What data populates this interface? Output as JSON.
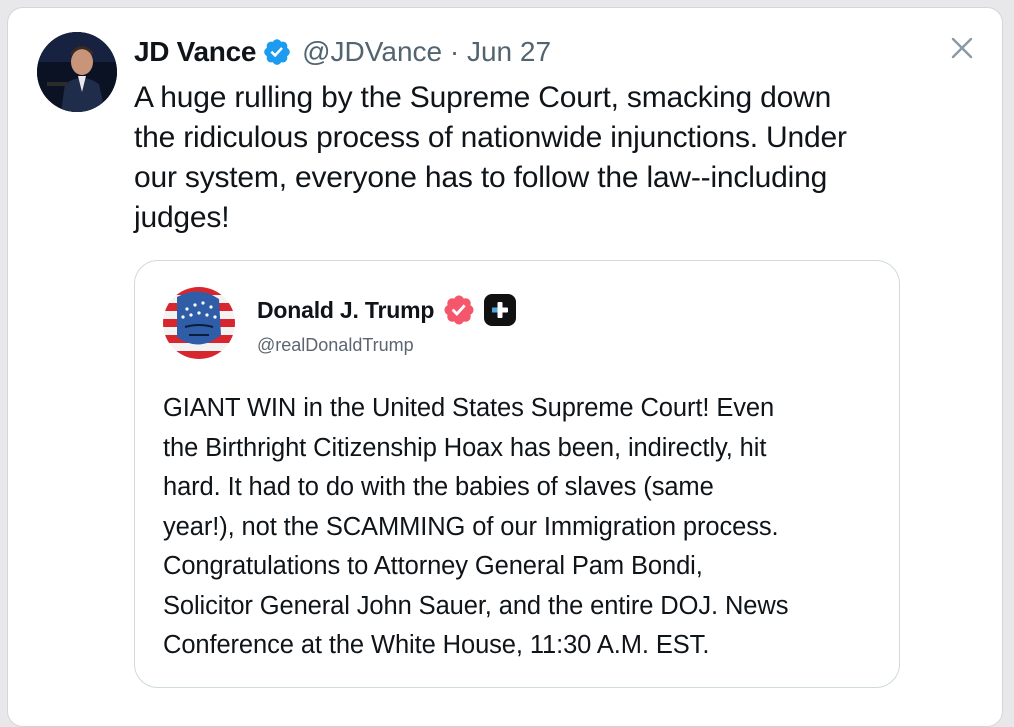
{
  "tweet": {
    "author_name": "JD Vance",
    "handle_date": "@JDVance · Jun 27",
    "text": "A huge rulling by the Supreme Court, smacking down\nthe ridiculous process of nationwide injunctions. Under\nour system, everyone has to follow the law--including\njudges!",
    "verified_icon": "verified-badge-icon",
    "verified_color": "#1d9bf0",
    "close_icon": "close-icon"
  },
  "quote": {
    "author_name": "Donald J. Trump",
    "handle": "@realDonaldTrump",
    "verified_icon": "verified-badge-icon",
    "verified_color": "#f4576b",
    "plus_icon": "plus-badge-icon",
    "text": "GIANT WIN in the United States Supreme Court! Even\nthe Birthright Citizenship Hoax has been, indirectly, hit\nhard. It had to do with the babies of slaves (same\nyear!), not the SCAMMING of our Immigration process.\nCongratulations to Attorney General Pam Bondi,\nSolicitor General John Sauer, and the entire DOJ. News\nConference at the White House, 11:30 A.M. EST."
  }
}
